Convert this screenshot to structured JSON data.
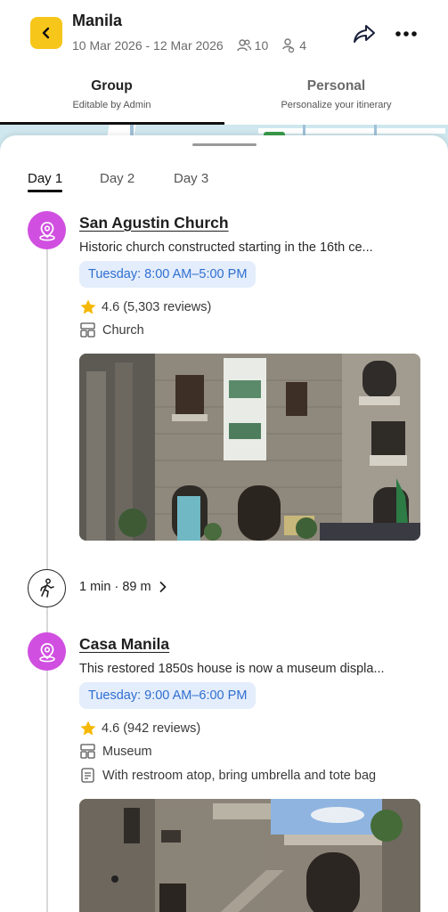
{
  "header": {
    "title": "Manila",
    "date_range": "10 Mar 2026 - 12 Mar 2026",
    "members_count": "10",
    "people_count": "4",
    "icons": {
      "back": "chevron-left-icon",
      "share": "share-arrow-icon",
      "more": "more-horizontal-icon",
      "members": "people-icon",
      "people": "person-stack-icon"
    }
  },
  "mode_tabs": [
    {
      "label": "Group",
      "sublabel": "Editable by Admin"
    },
    {
      "label": "Personal",
      "sublabel": "Personalize your itinerary"
    }
  ],
  "day_tabs": [
    "Day 1",
    "Day 2",
    "Day 3"
  ],
  "places": [
    {
      "title": "San Agustin Church",
      "description": "Historic church constructed starting in the 16th ce...",
      "hours": "Tuesday: 8:00 AM–5:00 PM",
      "rating": "4.6",
      "reviews": "(5,303 reviews)",
      "category": "Church"
    },
    {
      "title": "Casa Manila",
      "description": "This restored 1850s house is now a museum displa...",
      "hours": "Tuesday: 9:00 AM–6:00 PM",
      "rating": "4.6",
      "reviews": "(942 reviews)",
      "category": "Museum",
      "note": "With restroom atop, bring umbrella and tote bag"
    }
  ],
  "transit": {
    "text": "1 min · 89 m"
  },
  "colors": {
    "accent_yellow": "#f7c61a",
    "pin_purple": "#d04fe0",
    "hours_bg": "#e4edfb",
    "hours_text": "#2f6fd0",
    "star": "#f5b800"
  }
}
